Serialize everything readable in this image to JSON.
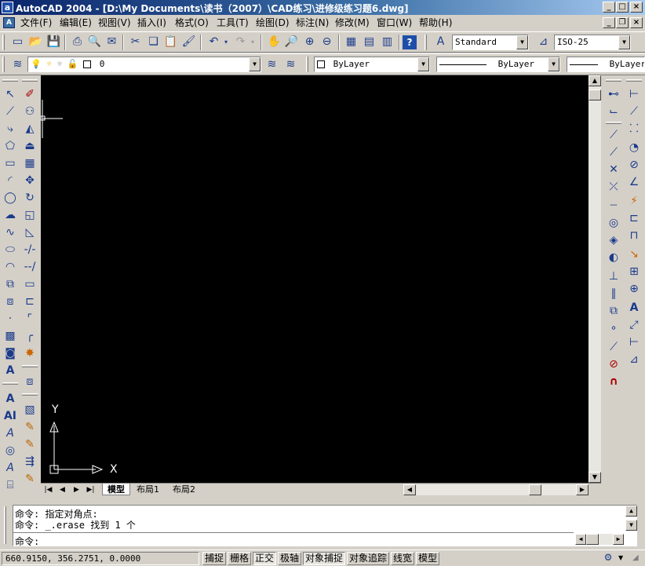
{
  "window": {
    "title": "AutoCAD 2004 - [D:\\My Documents\\读书（2007）\\CAD练习\\进修级练习题6.dwg]",
    "controls": {
      "minimize": "_",
      "maximize": "□",
      "close": "×"
    }
  },
  "menu": {
    "items": [
      "文件(F)",
      "编辑(E)",
      "视图(V)",
      "插入(I)",
      "格式(O)",
      "工具(T)",
      "绘图(D)",
      "标注(N)",
      "修改(M)",
      "窗口(W)",
      "帮助(H)"
    ]
  },
  "toolbar": {
    "text_style": "Standard",
    "dim_style": "ISO-25",
    "layer": "0",
    "color": "ByLayer",
    "linetype": "ByLayer",
    "lineweight": "ByLayer"
  },
  "canvas": {
    "background": "#000000",
    "ucs_y_label": "Y",
    "ucs_x_label": "X"
  },
  "tabs": [
    "模型",
    "布局1",
    "布局2"
  ],
  "command": {
    "history": [
      "命令: 指定对角点:",
      "命令: _.erase 找到 1 个"
    ],
    "prompt": "命令:"
  },
  "status": {
    "coordinates": "660.9150, 356.2751, 0.0000",
    "toggles": [
      {
        "label": "捕捉",
        "on": false
      },
      {
        "label": "栅格",
        "on": false
      },
      {
        "label": "正交",
        "on": true
      },
      {
        "label": "极轴",
        "on": false
      },
      {
        "label": "对象捕捉",
        "on": true
      },
      {
        "label": "对象追踪",
        "on": false
      },
      {
        "label": "线宽",
        "on": false
      },
      {
        "label": "模型",
        "on": false
      }
    ]
  }
}
